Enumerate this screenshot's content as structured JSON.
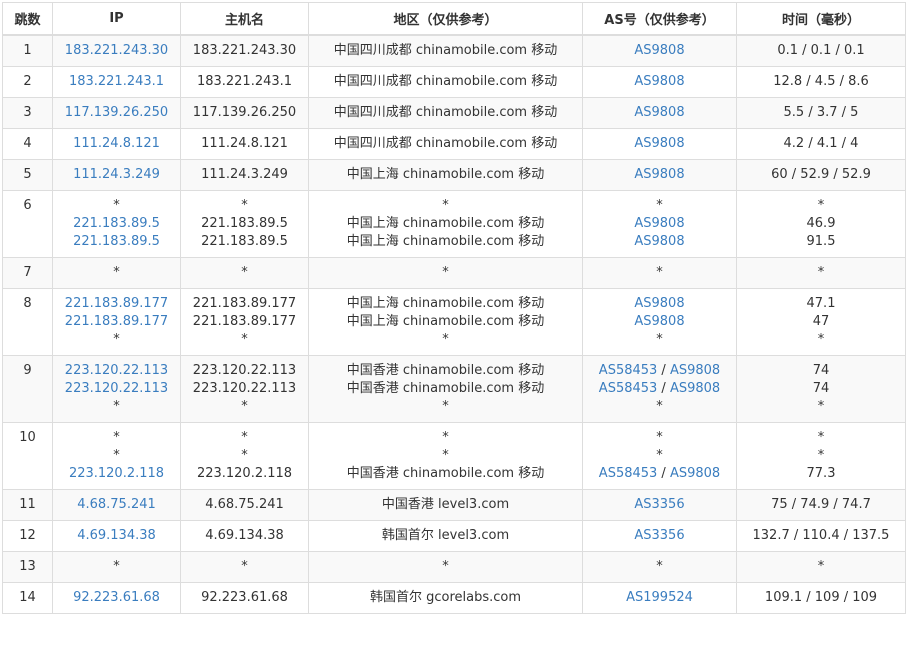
{
  "header": {
    "hop": "跳数",
    "ip": "IP",
    "host": "主机名",
    "region": "地区（仅供参考）",
    "as": "AS号（仅供参考）",
    "time": "时间（毫秒）"
  },
  "rows": [
    {
      "hop": "1",
      "lines": [
        {
          "ip": "183.221.243.30",
          "host": "183.221.243.30",
          "region": "中国四川成都 chinamobile.com 移动",
          "as": [
            "AS9808"
          ],
          "time": "0.1 / 0.1 / 0.1"
        }
      ]
    },
    {
      "hop": "2",
      "lines": [
        {
          "ip": "183.221.243.1",
          "host": "183.221.243.1",
          "region": "中国四川成都 chinamobile.com 移动",
          "as": [
            "AS9808"
          ],
          "time": "12.8 / 4.5 / 8.6"
        }
      ]
    },
    {
      "hop": "3",
      "lines": [
        {
          "ip": "117.139.26.250",
          "host": "117.139.26.250",
          "region": "中国四川成都 chinamobile.com 移动",
          "as": [
            "AS9808"
          ],
          "time": "5.5 / 3.7 / 5"
        }
      ]
    },
    {
      "hop": "4",
      "lines": [
        {
          "ip": "111.24.8.121",
          "host": "111.24.8.121",
          "region": "中国四川成都 chinamobile.com 移动",
          "as": [
            "AS9808"
          ],
          "time": "4.2 / 4.1 / 4"
        }
      ]
    },
    {
      "hop": "5",
      "lines": [
        {
          "ip": "111.24.3.249",
          "host": "111.24.3.249",
          "region": "中国上海 chinamobile.com 移动",
          "as": [
            "AS9808"
          ],
          "time": "60 / 52.9 / 52.9"
        }
      ]
    },
    {
      "hop": "6",
      "lines": [
        {
          "ip": "*",
          "host": "*",
          "region": "*",
          "as": [],
          "as_text": "*",
          "time": "*"
        },
        {
          "ip": "221.183.89.5",
          "host": "221.183.89.5",
          "region": "中国上海 chinamobile.com 移动",
          "as": [
            "AS9808"
          ],
          "time": "46.9"
        },
        {
          "ip": "221.183.89.5",
          "host": "221.183.89.5",
          "region": "中国上海 chinamobile.com 移动",
          "as": [
            "AS9808"
          ],
          "time": "91.5"
        }
      ]
    },
    {
      "hop": "7",
      "lines": [
        {
          "ip": "*",
          "host": "*",
          "region": "*",
          "as": [],
          "as_text": "*",
          "time": "*"
        }
      ]
    },
    {
      "hop": "8",
      "lines": [
        {
          "ip": "221.183.89.177",
          "host": "221.183.89.177",
          "region": "中国上海 chinamobile.com 移动",
          "as": [
            "AS9808"
          ],
          "time": "47.1"
        },
        {
          "ip": "221.183.89.177",
          "host": "221.183.89.177",
          "region": "中国上海 chinamobile.com 移动",
          "as": [
            "AS9808"
          ],
          "time": "47"
        },
        {
          "ip": "*",
          "host": "*",
          "region": "*",
          "as": [],
          "as_text": "*",
          "time": "*"
        }
      ]
    },
    {
      "hop": "9",
      "lines": [
        {
          "ip": "223.120.22.113",
          "host": "223.120.22.113",
          "region": "中国香港 chinamobile.com 移动",
          "as": [
            "AS58453",
            "AS9808"
          ],
          "time": "74"
        },
        {
          "ip": "223.120.22.113",
          "host": "223.120.22.113",
          "region": "中国香港 chinamobile.com 移动",
          "as": [
            "AS58453",
            "AS9808"
          ],
          "time": "74"
        },
        {
          "ip": "*",
          "host": "*",
          "region": "*",
          "as": [],
          "as_text": "*",
          "time": "*"
        }
      ]
    },
    {
      "hop": "10",
      "lines": [
        {
          "ip": "*",
          "host": "*",
          "region": "*",
          "as": [],
          "as_text": "*",
          "time": "*"
        },
        {
          "ip": "*",
          "host": "*",
          "region": "*",
          "as": [],
          "as_text": "*",
          "time": "*"
        },
        {
          "ip": "223.120.2.118",
          "host": "223.120.2.118",
          "region": "中国香港 chinamobile.com 移动",
          "as": [
            "AS58453",
            "AS9808"
          ],
          "time": "77.3"
        }
      ]
    },
    {
      "hop": "11",
      "lines": [
        {
          "ip": "4.68.75.241",
          "host": "4.68.75.241",
          "region": "中国香港 level3.com",
          "as": [
            "AS3356"
          ],
          "time": "75 / 74.9 / 74.7"
        }
      ]
    },
    {
      "hop": "12",
      "lines": [
        {
          "ip": "4.69.134.38",
          "host": "4.69.134.38",
          "region": "韩国首尔 level3.com",
          "as": [
            "AS3356"
          ],
          "time": "132.7 / 110.4 / 137.5"
        }
      ]
    },
    {
      "hop": "13",
      "lines": [
        {
          "ip": "*",
          "host": "*",
          "region": "*",
          "as": [],
          "as_text": "*",
          "time": "*"
        }
      ]
    },
    {
      "hop": "14",
      "lines": [
        {
          "ip": "92.223.61.68",
          "host": "92.223.61.68",
          "region": "韩国首尔 gcorelabs.com",
          "as": [
            "AS199524"
          ],
          "time": "109.1 / 109 / 109"
        }
      ]
    }
  ],
  "as_separator": " / ",
  "colors": {
    "link": "#3a7dbf",
    "border": "#dddddd",
    "stripe": "#f9f9f9"
  }
}
